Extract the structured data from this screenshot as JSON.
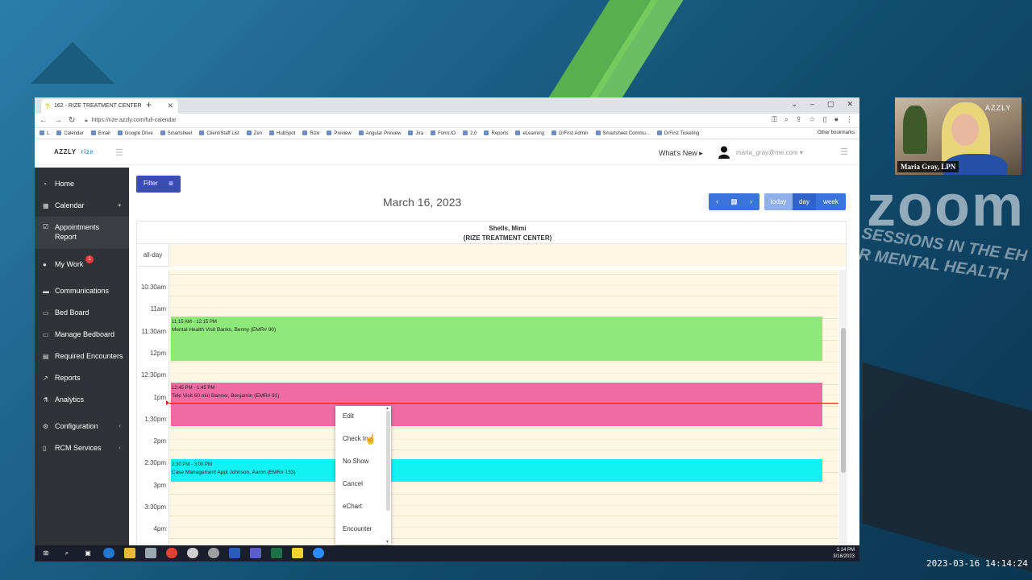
{
  "browser": {
    "tab_title": "162 - RIZE TREATMENT CENTER",
    "url": "https://rize.azzly.com/full-calendar",
    "bookmarks": [
      "L",
      "Calendar",
      "Email",
      "Google Drive",
      "Smartsheet",
      "Client/Staff List",
      "Zen",
      "HubSpot",
      "Rize",
      "Preview",
      "Angular Preview",
      "Jira",
      "Form.IO",
      "2.0",
      "Reports",
      "eLearning",
      "DrFirst Admin",
      "Smartsheet Commu...",
      "DrFirst Ticketing"
    ],
    "other_bookmarks": "Other bookmarks"
  },
  "app": {
    "logo_left": "AZZLY",
    "logo_right": "rize",
    "whats_new": "What's New",
    "user_email": "maria_gray@me.com"
  },
  "sidebar": {
    "items": [
      {
        "label": "Home",
        "icon": "home-icon"
      },
      {
        "label": "Calendar",
        "icon": "calendar-icon"
      },
      {
        "label": "Appointments Report",
        "icon": "report-icon"
      },
      {
        "label": "My Work",
        "icon": "user-icon",
        "badge": "1"
      },
      {
        "label": "Communications",
        "icon": "chat-icon"
      },
      {
        "label": "Bed Board",
        "icon": "bed-icon"
      },
      {
        "label": "Manage Bedboard",
        "icon": "bed-icon"
      },
      {
        "label": "Required Encounters",
        "icon": "clipboard-icon"
      },
      {
        "label": "Reports",
        "icon": "chart-icon"
      },
      {
        "label": "Analytics",
        "icon": "analytics-icon"
      },
      {
        "label": "Configuration",
        "icon": "gear-icon"
      },
      {
        "label": "RCM Services",
        "icon": "document-icon"
      }
    ]
  },
  "calendar": {
    "filter_label": "Filter",
    "date_title": "March 16, 2023",
    "views": {
      "today": "today",
      "day": "day",
      "week": "week"
    },
    "resource_name": "Shells, Mimi",
    "resource_org": "(RIZE TREATMENT CENTER)",
    "allday_label": "all-day",
    "times": [
      "10:30am",
      "11am",
      "11:30am",
      "12pm",
      "12:30pm",
      "1pm",
      "1:30pm",
      "2pm",
      "2:30pm",
      "3pm",
      "3:30pm",
      "4pm"
    ],
    "events": [
      {
        "time": "11:15 AM - 12:15 PM",
        "title": "Mental Health Visit Banks, Benny (EMR# 90)",
        "color": "#8ee87a"
      },
      {
        "time": "12:45 PM - 1:45 PM",
        "title": "Tele Visit 60 min Banner, Benjamin (EMR# 91)",
        "color": "#f06aa4"
      },
      {
        "time": "2:30 PM - 3:00 PM",
        "title": "Case Management Appt Johnson, Aaron (EMR# 133)",
        "color": "#13f2f2"
      }
    ]
  },
  "context_menu": {
    "items": [
      "Edit",
      "Check In",
      "No Show",
      "Cancel",
      "eChart",
      "Encounter"
    ]
  },
  "taskbar": {
    "time": "1:14 PM",
    "date": "3/16/2023"
  },
  "zoom_overlay": {
    "participant": "Maria Gray, LPN",
    "bg_text": "zoom",
    "bg_subtext": "SESSIONS IN THE EH R MENTAL HEALTH",
    "recording_timestamp": "2023-03-16  14:14:24",
    "cam_sign": "AZZLY"
  }
}
